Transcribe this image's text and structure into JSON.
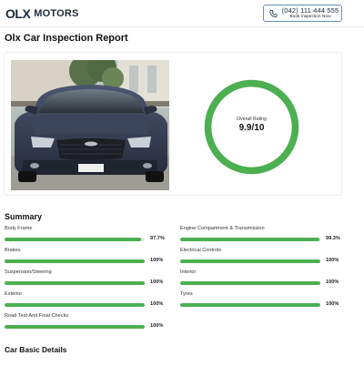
{
  "header": {
    "logo_mark": "OLX",
    "logo_text": "MOTORS",
    "phone": "(042) 111 444 555",
    "cta_label": "Book Inspection Now"
  },
  "page_title": "Olx Car Inspection Report",
  "rating": {
    "label": "Overall Rating",
    "value": "9.9/10",
    "fraction": 0.99,
    "color": "#4caf50"
  },
  "summary": {
    "title": "Summary",
    "items": [
      {
        "label": "Body Frame",
        "value": "97.7%",
        "fraction": 0.977
      },
      {
        "label": "Engine Compartment & Transmission",
        "value": "99.3%",
        "fraction": 0.993
      },
      {
        "label": "Brakes",
        "value": "100%",
        "fraction": 1.0
      },
      {
        "label": "Electrical Controls",
        "value": "100%",
        "fraction": 1.0
      },
      {
        "label": "Suspension/Steering",
        "value": "100%",
        "fraction": 1.0
      },
      {
        "label": "Interior",
        "value": "100%",
        "fraction": 1.0
      },
      {
        "label": "Exterior",
        "value": "100%",
        "fraction": 1.0
      },
      {
        "label": "Tyres",
        "value": "100%",
        "fraction": 1.0
      },
      {
        "label": "Road Test And Final Checks",
        "value": "100%",
        "fraction": 1.0
      }
    ]
  },
  "basic_details": {
    "title": "Car Basic Details"
  }
}
